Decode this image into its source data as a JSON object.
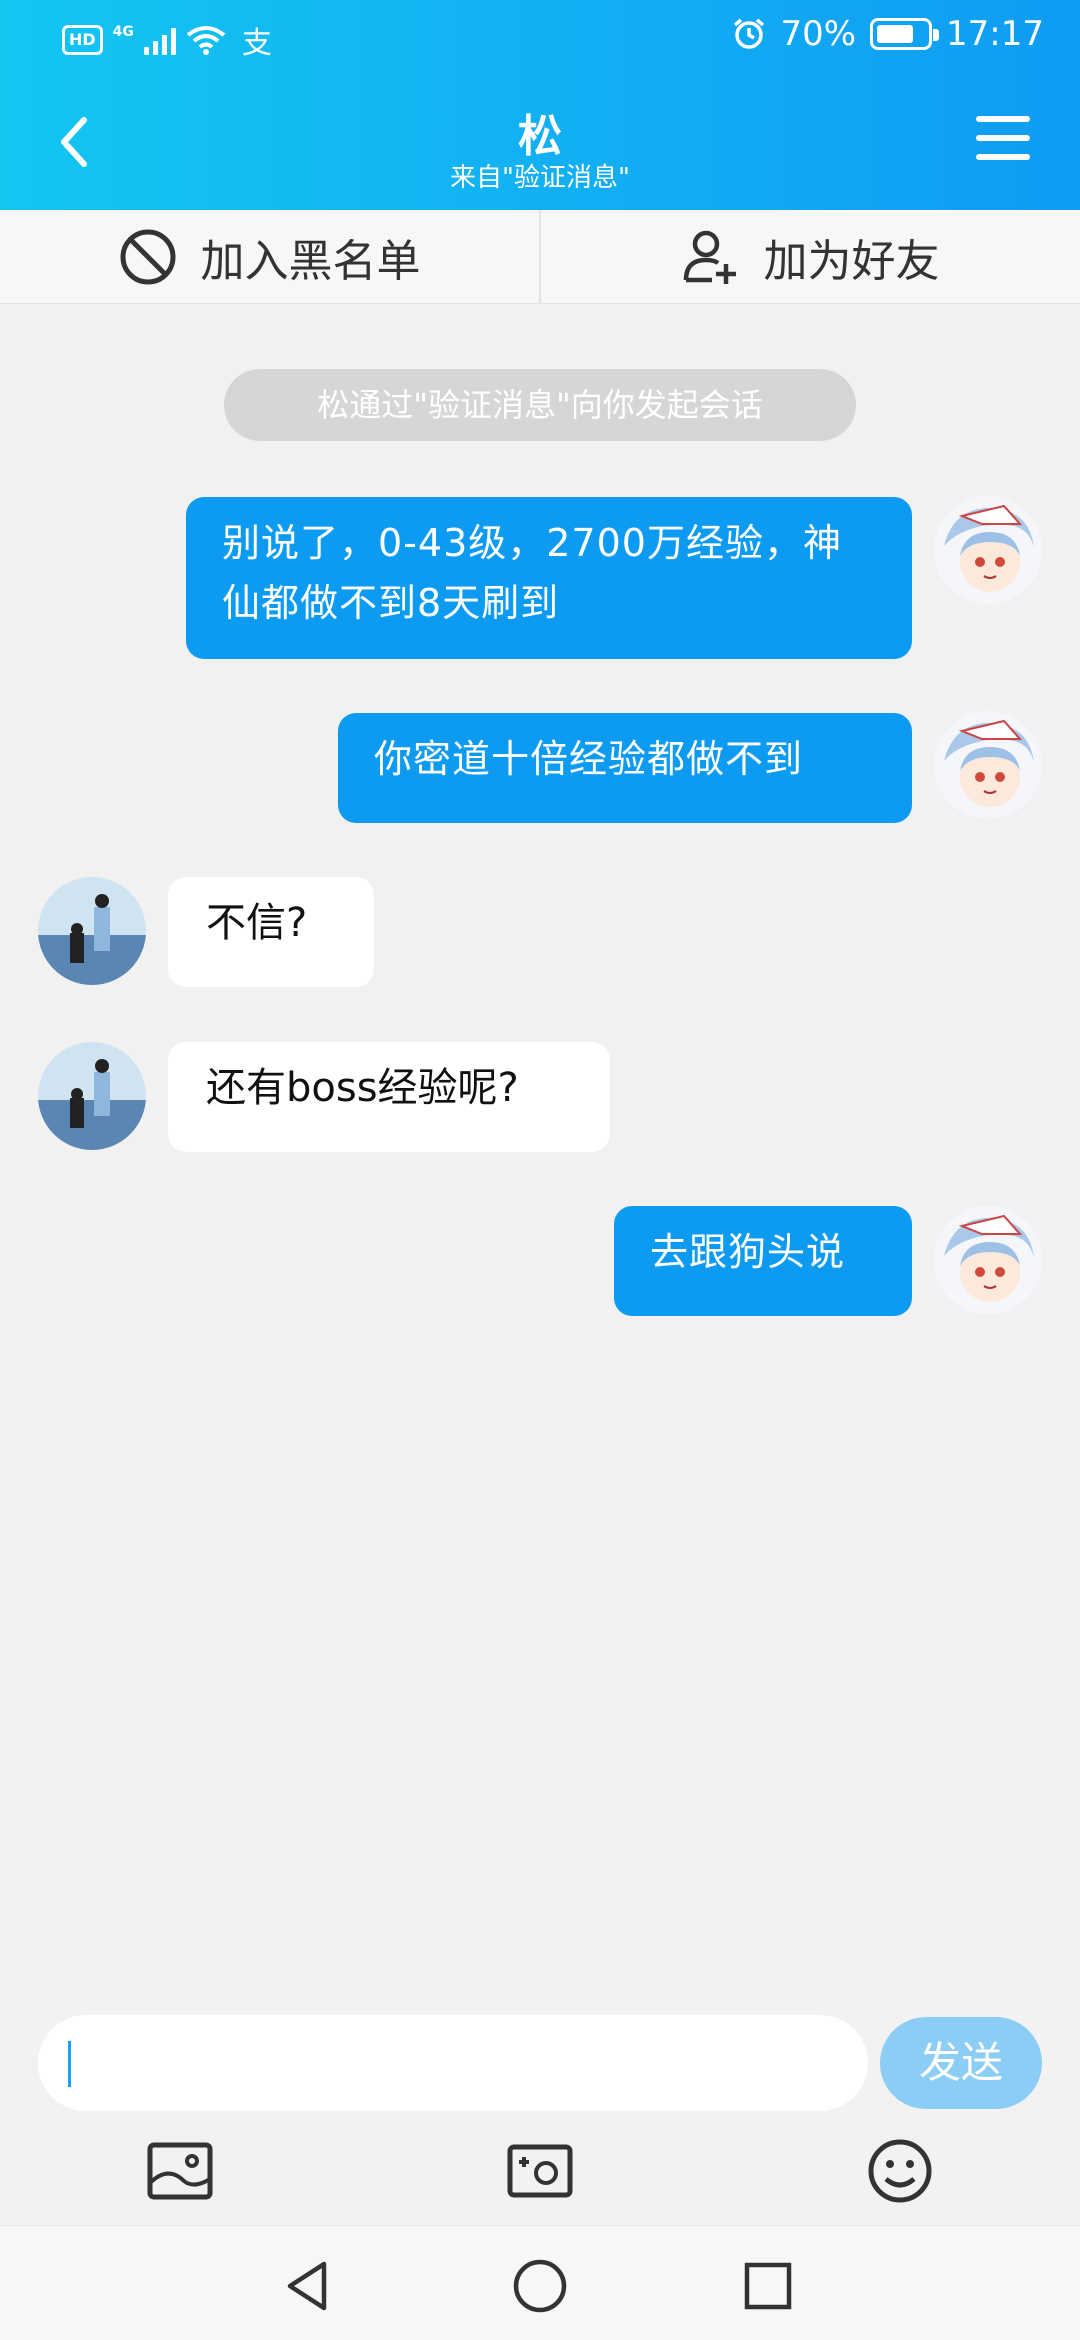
{
  "status_bar": {
    "hd": "HD",
    "network": "4G",
    "battery": "70%",
    "time": "17:17"
  },
  "header": {
    "title": "松",
    "subtitle": "来自\"验证消息\""
  },
  "actions": {
    "block": "加入黑名单",
    "add_friend": "加为好友"
  },
  "system_message": "松通过\"验证消息\"向你发起会话",
  "messages": [
    {
      "side": "out",
      "text": "别说了，0-43级，2700万经验，神仙都做不到8天刷到"
    },
    {
      "side": "out",
      "text": "你密道十倍经验都做不到"
    },
    {
      "side": "in",
      "text": "不信?"
    },
    {
      "side": "in",
      "text": "还有boss经验呢?"
    },
    {
      "side": "out",
      "text": "去跟狗头说"
    }
  ],
  "input": {
    "value": "",
    "send_label": "发送"
  },
  "icons": {
    "back": "chevron-left-icon",
    "menu": "hamburger-menu-icon",
    "block": "block-icon",
    "add_friend": "add-person-icon",
    "image": "image-icon",
    "camera": "camera-icon",
    "emoji": "emoji-icon"
  },
  "colors": {
    "header_start": "#12c6f2",
    "header_end": "#0f9cf3",
    "outgoing_bubble": "#0d9bf2",
    "incoming_bubble": "#ffffff",
    "send_button": "#8ccdf6"
  }
}
